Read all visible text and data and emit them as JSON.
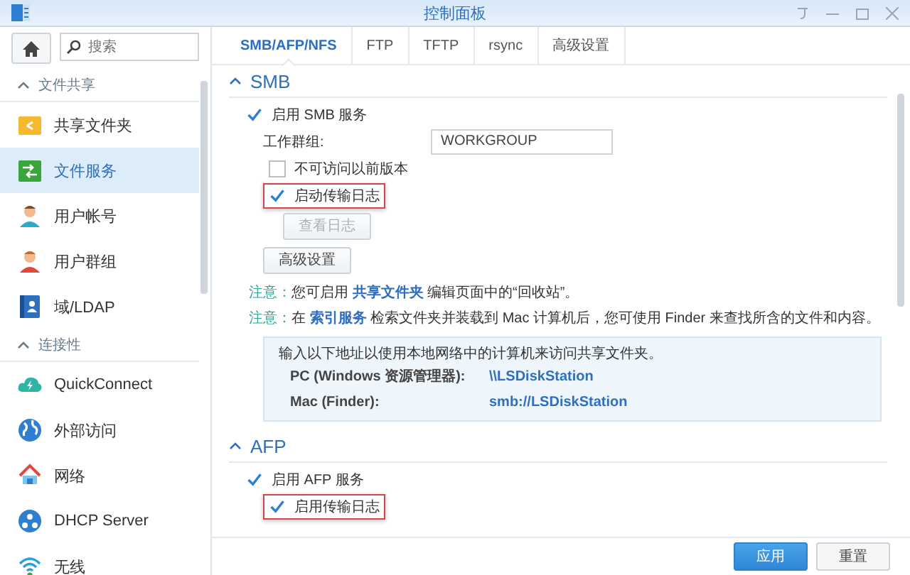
{
  "window": {
    "title": "控制面板"
  },
  "sidebar": {
    "search": {
      "placeholder": "搜索"
    },
    "sections": [
      {
        "title": "文件共享",
        "expanded": true,
        "items": [
          {
            "label": "共享文件夹",
            "selected": false
          },
          {
            "label": "文件服务",
            "selected": true
          },
          {
            "label": "用户帐号",
            "selected": false
          },
          {
            "label": "用户群组",
            "selected": false
          },
          {
            "label": "域/LDAP",
            "selected": false
          }
        ]
      },
      {
        "title": "连接性",
        "expanded": true,
        "items": [
          {
            "label": "QuickConnect",
            "selected": false
          },
          {
            "label": "外部访问",
            "selected": false
          },
          {
            "label": "网络",
            "selected": false
          },
          {
            "label": "DHCP Server",
            "selected": false
          },
          {
            "label": "无线",
            "selected": false
          }
        ]
      }
    ]
  },
  "tabs": [
    {
      "label": "SMB/AFP/NFS",
      "selected": true
    },
    {
      "label": "FTP",
      "selected": false
    },
    {
      "label": "TFTP",
      "selected": false
    },
    {
      "label": "rsync",
      "selected": false
    },
    {
      "label": "高级设置",
      "selected": false
    }
  ],
  "smb": {
    "title": "SMB",
    "expanded": true,
    "enable": {
      "label": "启用 SMB 服务",
      "checked": true
    },
    "workgroup": {
      "label": "工作群组:",
      "value": "WORKGROUP"
    },
    "previous_versions": {
      "label": "不可访问以前版本",
      "checked": false
    },
    "transfer_log": {
      "label": "启动传输日志",
      "checked": true,
      "highlighted": true
    },
    "view_log_button": {
      "label": "查看日志",
      "disabled": true
    },
    "advanced_button": {
      "label": "高级设置"
    },
    "notes": [
      {
        "prefix": "注意：",
        "before": "您可启用 ",
        "link": "共享文件夹",
        "after": " 编辑页面中的“回收站”。"
      },
      {
        "prefix": "注意：",
        "before": "在 ",
        "link": "索引服务",
        "after": " 检索文件夹并装载到 Mac 计算机后，您可使用 Finder 来查找所含的文件和内容。"
      }
    ],
    "info": {
      "intro": "输入以下地址以使用本地网络中的计算机来访问共享文件夹。",
      "rows": [
        {
          "label": "PC (Windows 资源管理器):",
          "value": "\\\\LSDiskStation"
        },
        {
          "label": "Mac (Finder):",
          "value": "smb://LSDiskStation"
        }
      ]
    }
  },
  "afp": {
    "title": "AFP",
    "expanded": true,
    "enable": {
      "label": "启用 AFP 服务",
      "checked": true
    },
    "transfer_log": {
      "label": "启用传输日志",
      "checked": true,
      "highlighted": true
    }
  },
  "footer": {
    "buttons": [
      {
        "label": "应用",
        "kind": "primary"
      },
      {
        "label": "重置",
        "kind": "secondary"
      }
    ]
  }
}
